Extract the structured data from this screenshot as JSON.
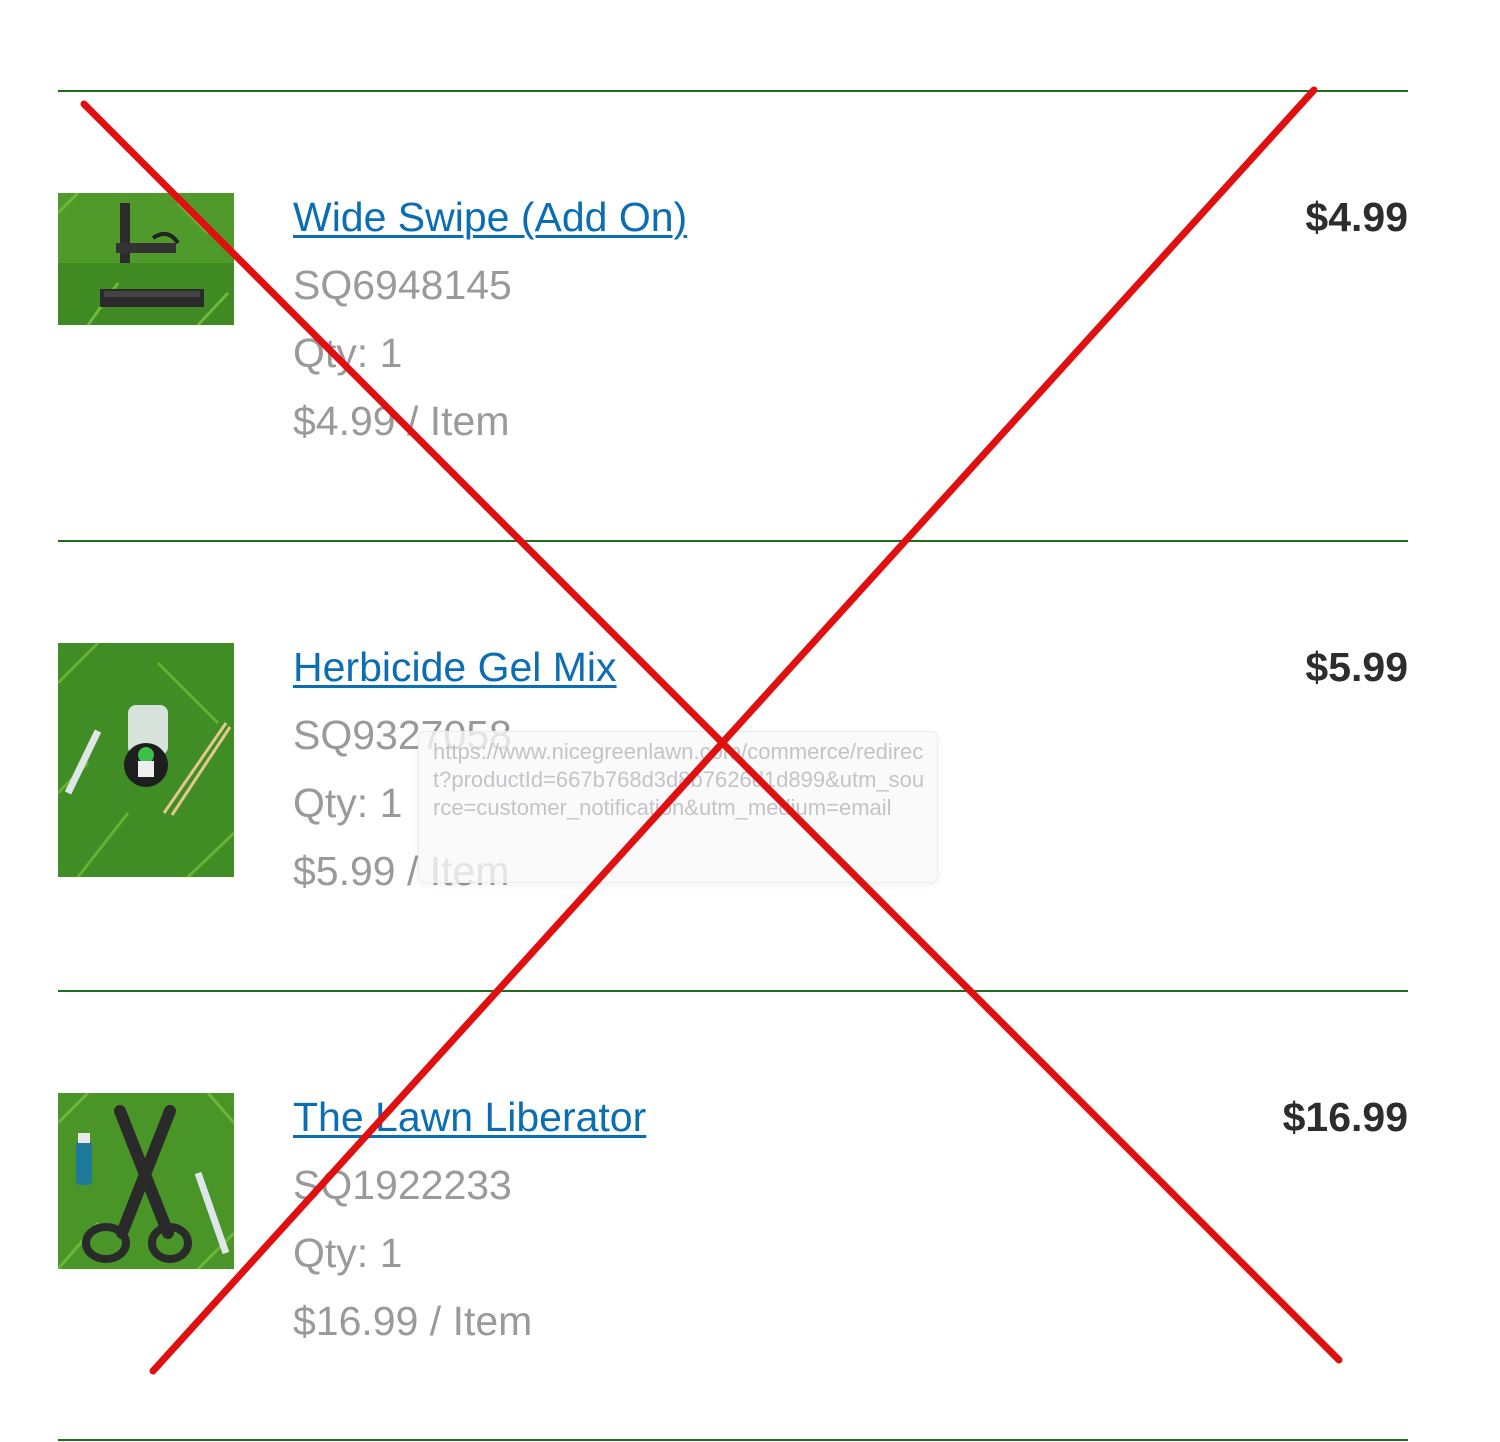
{
  "order_items": [
    {
      "name": "Wide Swipe (Add On)",
      "sku": "SQ6948145",
      "qty": "Qty: 1",
      "unit_price": "$4.99 / Item",
      "total": "$4.99",
      "image_icon": "wide-swipe-product-photo"
    },
    {
      "name": "Herbicide Gel Mix",
      "sku": "SQ9327058",
      "qty": "Qty: 1",
      "unit_price": "$5.99 / Item",
      "total": "$5.99",
      "image_icon": "herbicide-gel-kit-product-photo"
    },
    {
      "name": "The Lawn Liberator",
      "sku": "SQ1922233",
      "qty": "Qty: 1",
      "unit_price": "$16.99 / Item",
      "total": "$16.99",
      "image_icon": "lawn-liberator-product-photo"
    }
  ],
  "link_tooltip": {
    "url": "https://www.nicegreenlawn.com/commerce/redirect?productId=667b768d3d8b7626d1d899&utm_source=customer_notification&utm_medium=email"
  },
  "colors": {
    "divider": "#1f6b1f",
    "link": "#0b6db3",
    "muted_text": "#9a9a9a",
    "total_text": "#2d2d2d",
    "cross_mark": "#e01010"
  }
}
